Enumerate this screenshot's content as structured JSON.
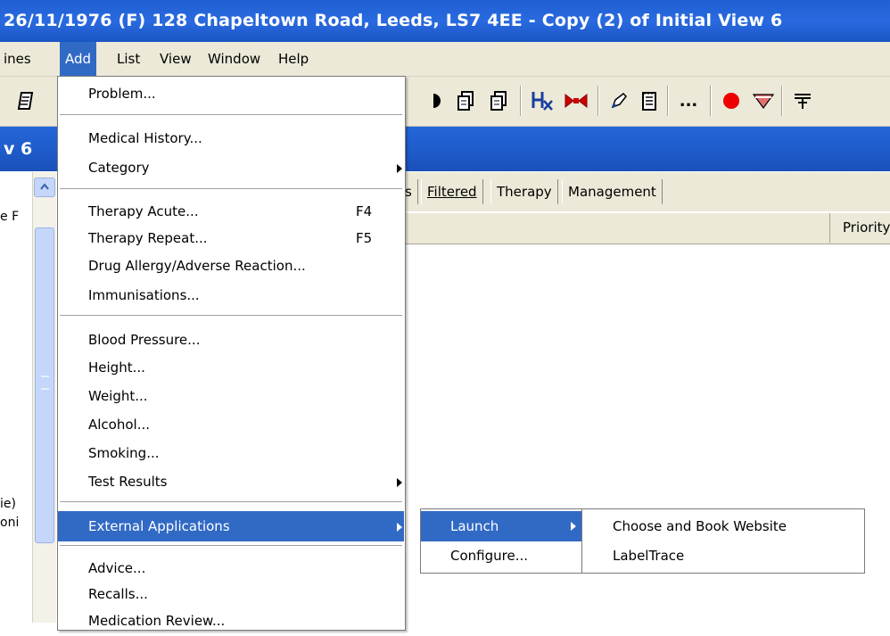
{
  "window": {
    "title": "26/11/1976 (F)  128 Chapeltown Road, Leeds, LS7 4EE - Copy (2) of Initial View 6"
  },
  "menubar": {
    "items": [
      {
        "label": "ines"
      },
      {
        "label": "Add",
        "active": true
      },
      {
        "label": "List"
      },
      {
        "label": "View"
      },
      {
        "label": "Window"
      },
      {
        "label": "Help"
      }
    ]
  },
  "toolbar": {
    "icons": [
      "notebook-icon",
      "copy-icon",
      "copy-icon",
      "history-icon",
      "bowtie-icon",
      "pencil-icon",
      "notepad-icon",
      "more-icon",
      "record-icon",
      "heart-pill-icon",
      "filter-icon"
    ],
    "more_label": "..."
  },
  "view_header": {
    "label": "v 6"
  },
  "left_pane": {
    "texts": [
      "e F",
      "ie)",
      "oni"
    ]
  },
  "tabs": {
    "items": [
      {
        "label": "s"
      },
      {
        "label": "Filtered"
      },
      {
        "label": "Therapy"
      },
      {
        "label": "Management"
      }
    ]
  },
  "grid": {
    "columns": [
      "Priority"
    ]
  },
  "add_menu": {
    "items": [
      {
        "label": "Problem..."
      },
      {
        "label": "Medical History..."
      },
      {
        "label": "Category"
      },
      {
        "label": "Therapy Acute...",
        "shortcut": "F4"
      },
      {
        "label": "Therapy Repeat...",
        "shortcut": "F5"
      },
      {
        "label": "Drug Allergy/Adverse Reaction..."
      },
      {
        "label": "Immunisations..."
      },
      {
        "label": "Blood Pressure..."
      },
      {
        "label": "Height..."
      },
      {
        "label": "Weight..."
      },
      {
        "label": "Alcohol..."
      },
      {
        "label": "Smoking..."
      },
      {
        "label": "Test Results"
      },
      {
        "label": "External Applications"
      },
      {
        "label": "Advice..."
      },
      {
        "label": "Recalls..."
      },
      {
        "label": "Medication Review..."
      }
    ]
  },
  "external_applications_menu": {
    "items": [
      {
        "label": "Launch"
      },
      {
        "label": "Configure..."
      }
    ]
  },
  "launch_menu": {
    "items": [
      {
        "label": "Choose and Book Website"
      },
      {
        "label": "LabelTrace"
      }
    ]
  },
  "colors": {
    "title_bar": "#2a6ae0",
    "highlight": "#316ac5",
    "menu_bg": "#ece9d8"
  }
}
